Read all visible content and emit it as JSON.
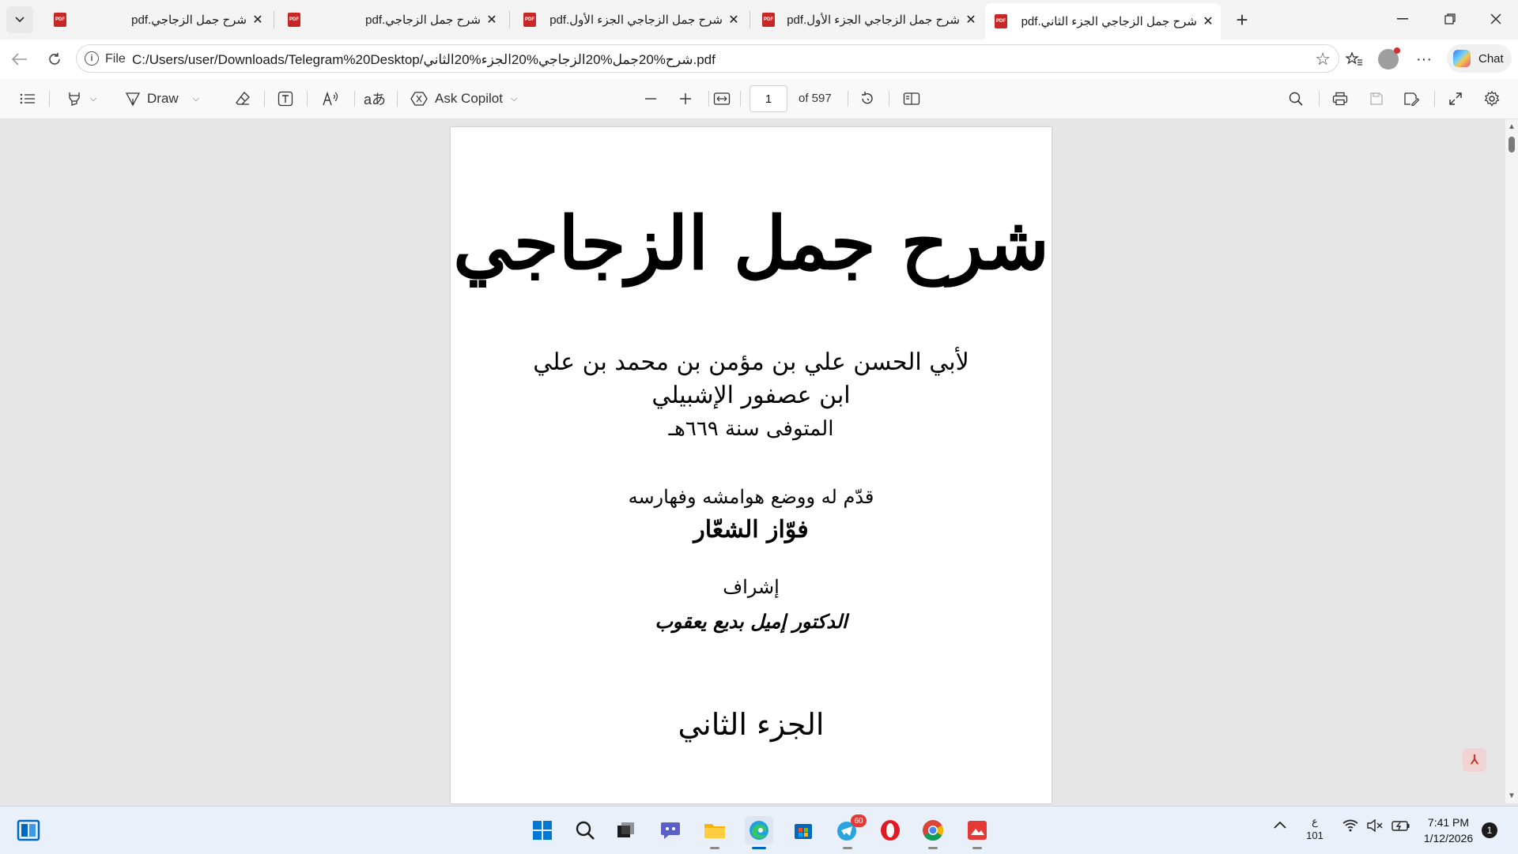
{
  "tabs": [
    {
      "label": "شرح جمل الزجاجي.pdf",
      "active": false
    },
    {
      "label": "شرح جمل الزجاجي.pdf",
      "active": false
    },
    {
      "label": "شرح جمل الزجاجي الجزء الأول.pdf",
      "active": false
    },
    {
      "label": "شرح جمل الزجاجي الجزء الأول.pdf",
      "active": false
    },
    {
      "label": "شرح جمل الزجاجي الجزء الثاني.pdf",
      "active": true
    }
  ],
  "address": {
    "prefix": "File",
    "url": "C:/Users/user/Downloads/Telegram%20Desktop/شرح%20جمل%20الزجاجي%20الجزء%20الثاني.pdf"
  },
  "chat_label": "Chat",
  "toolbar": {
    "draw_label": "Draw",
    "copilot_label": "Ask Copilot",
    "page_number": "1",
    "page_count": "of 597"
  },
  "page": {
    "title": "شرح جمل الزجاجي",
    "author_line1": "لأبي الحسن علي بن مؤمن بن محمد بن علي",
    "author_line2": "ابن عصفور الإشبيلي",
    "author_line3": "المتوفى سنة ٦٦٩هـ",
    "editor_intro": "قدّم له ووضع هوامشه وفهارسه",
    "editor_name": "فوّاز الشعّار",
    "supervision_label": "إشراف",
    "supervisor_name": "الدكتور إميل بديع يعقوب",
    "volume": "الجزء الثاني"
  },
  "taskbar": {
    "telegram_badge": "60",
    "lang_top": "ع",
    "lang_bottom": "101",
    "time": "7:41 PM",
    "date": "1/12/2026",
    "notifications": "1"
  },
  "colors": {
    "accent": "#0067c0",
    "pdf_icon": "#c62828"
  }
}
